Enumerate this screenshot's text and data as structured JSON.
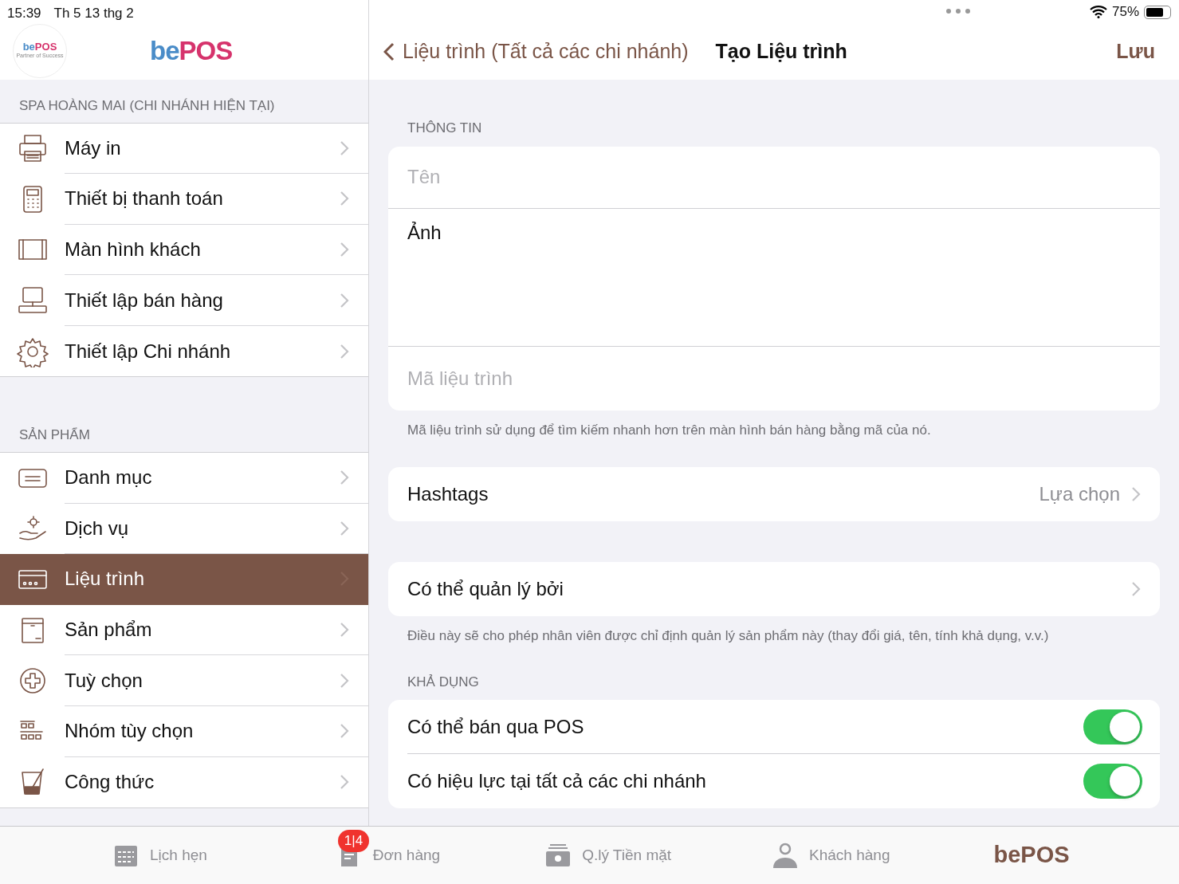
{
  "status_bar": {
    "time": "15:39",
    "date": "Th 5 13 thg 2",
    "battery": "75%"
  },
  "sidebar": {
    "logo_small": {
      "parts": [
        "be",
        "POS"
      ],
      "tagline": "Partner of Success"
    },
    "logo": {
      "parts": [
        "be",
        "POS"
      ]
    },
    "sections": [
      {
        "title": "SPA HOÀNG MAI  (CHI NHÁNH HIỆN TẠI)",
        "items": [
          {
            "label": "Máy in",
            "selected": false
          },
          {
            "label": "Thiết bị thanh toán",
            "selected": false
          },
          {
            "label": "Màn hình khách",
            "selected": false
          },
          {
            "label": "Thiết lập bán hàng",
            "selected": false
          },
          {
            "label": "Thiết lập Chi nhánh",
            "selected": false
          }
        ]
      },
      {
        "title": "SẢN PHẨM",
        "items": [
          {
            "label": "Danh mục",
            "selected": false
          },
          {
            "label": "Dịch vụ",
            "selected": false
          },
          {
            "label": "Liệu trình",
            "selected": true
          },
          {
            "label": "Sản phẩm",
            "selected": false
          },
          {
            "label": "Tuỳ chọn",
            "selected": false
          },
          {
            "label": "Nhóm tùy chọn",
            "selected": false
          },
          {
            "label": "Công thức",
            "selected": false
          }
        ]
      }
    ]
  },
  "nav": {
    "back": "Liệu trình (Tất cả các chi nhánh)",
    "title": "Tạo Liệu trình",
    "action": "Lưu"
  },
  "form": {
    "info_header": "THÔNG TIN",
    "name_placeholder": "Tên",
    "image_label": "Ảnh",
    "code_placeholder": "Mã liệu trình",
    "code_note": "Mã liệu trình sử dụng để tìm kiếm nhanh hơn trên màn hình bán hàng bằng mã của nó.",
    "hashtags": {
      "label": "Hashtags",
      "value": "Lựa chọn"
    },
    "managed": {
      "label": "Có thể quản lý bởi",
      "note": "Điều này sẽ cho phép nhân viên được chỉ định quản lý sản phẩm này (thay đổi giá, tên, tính khả dụng, v.v.)"
    },
    "availability_header": "KHẢ DỤNG",
    "toggles": [
      {
        "label": "Có thể bán qua POS",
        "on": true
      },
      {
        "label": "Có hiệu lực tại tất cả các chi nhánh",
        "on": true
      }
    ]
  },
  "tab_bar": {
    "items": [
      {
        "label": "Lịch hẹn"
      },
      {
        "label": "Đơn hàng",
        "badge": "1|4"
      },
      {
        "label": "Q.lý Tiền mặt"
      },
      {
        "label": "Khách hàng"
      }
    ],
    "brand": "bePOS"
  }
}
